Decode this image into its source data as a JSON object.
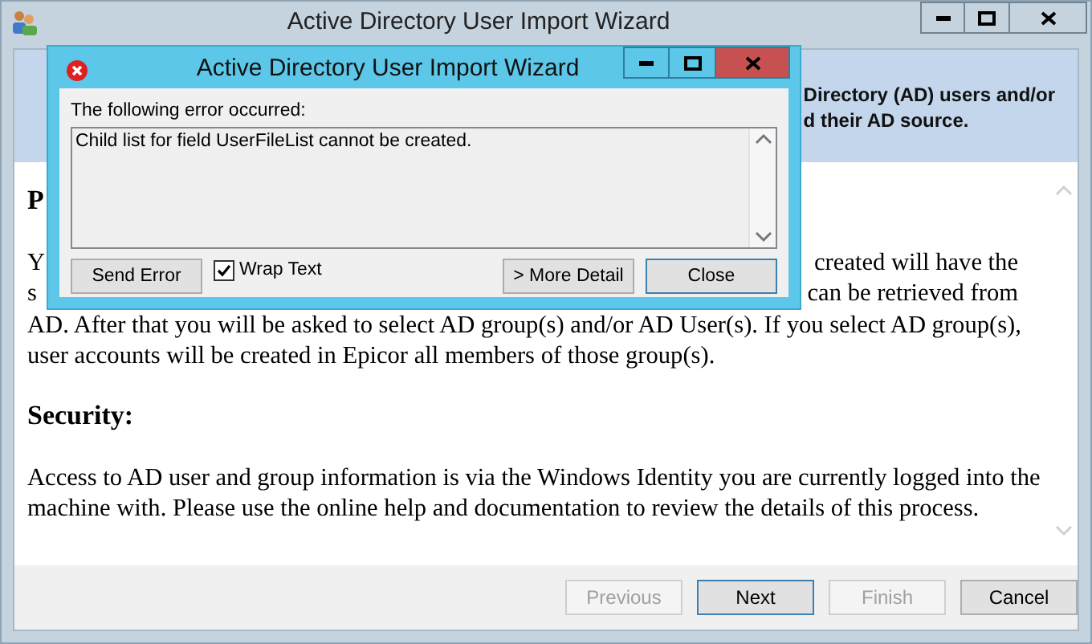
{
  "main_window": {
    "title": "Active Directory User Import Wizard"
  },
  "banner": {
    "lines": [
      "Directory (AD) users and/or",
      "d their AD source."
    ]
  },
  "sections": [
    {
      "heading": "P",
      "lines": [
        [
          "Y",
          "created will have the"
        ],
        [
          "s",
          "can be retrieved from"
        ],
        [
          "AD. After that you will be asked to select AD group(s) and/or AD User(s). If you select AD group(s),"
        ],
        [
          "user accounts will be created in Epicor all members of those group(s)."
        ]
      ]
    },
    {
      "heading": "Security:",
      "lines": [
        [
          "Access to AD user and group information is via the Windows Identity you are currently logged into the"
        ],
        [
          "machine with. Please use the online help and documentation to review the details of this process."
        ]
      ]
    }
  ],
  "footer_buttons": [
    {
      "label": "Previous",
      "disabled": true,
      "default": false
    },
    {
      "label": "Next",
      "disabled": false,
      "default": true
    },
    {
      "label": "Finish",
      "disabled": true,
      "default": false
    },
    {
      "label": "Cancel",
      "disabled": false,
      "default": false
    }
  ],
  "dialog": {
    "title": "Active Directory User Import Wizard",
    "message_label": "The following error occurred:",
    "error_text": "Child list for field UserFileList cannot be created.",
    "send_button": "Send Error",
    "wrap_text": {
      "label": "Wrap Text",
      "checked": true
    },
    "buttons": [
      {
        "label": "> More Detail",
        "default": false
      },
      {
        "label": "Close",
        "default": true
      }
    ]
  }
}
